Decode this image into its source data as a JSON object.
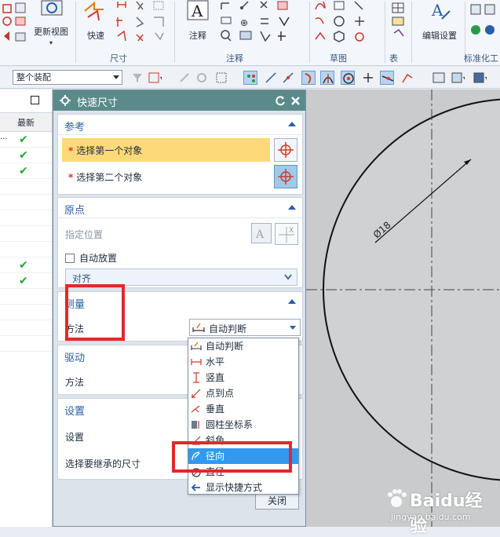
{
  "ribbon": {
    "groups": [
      {
        "label": "尺寸"
      },
      {
        "label": "注释"
      },
      {
        "label": "草图"
      },
      {
        "label": "表"
      },
      {
        "label": "标准化工"
      }
    ],
    "buttons": {
      "update_view": "更新视图",
      "quick": "快速",
      "note": "注释",
      "edit_settings": "编辑设置"
    }
  },
  "toolbar": {
    "assembly_filter": "整个装配"
  },
  "left_nav": {
    "column_latest": "最新",
    "truncated_text": "..."
  },
  "dialog": {
    "title": "快速尺寸",
    "reference": {
      "label": "参考",
      "first_object": "选择第一个对象",
      "second_object": "选择第二个对象",
      "required_mark": "*"
    },
    "origin": {
      "label": "原点",
      "specify_location": "指定位置",
      "auto_place": "自动放置",
      "align": "对齐"
    },
    "measure": {
      "label": "测量",
      "method_label": "方法",
      "method_value": "自动判断"
    },
    "drive": {
      "label": "驱动",
      "method_label": "方法"
    },
    "settings": {
      "label": "设置",
      "settings_label": "设置",
      "inherit_label": "选择要继承的尺寸"
    },
    "close_label": "关闭"
  },
  "method_options": [
    {
      "label": "自动判断",
      "icon": "auto-infer-icon"
    },
    {
      "label": "水平",
      "icon": "horizontal-dim-icon"
    },
    {
      "label": "竖直",
      "icon": "vertical-dim-icon"
    },
    {
      "label": "点到点",
      "icon": "point-to-point-icon"
    },
    {
      "label": "垂直",
      "icon": "perpendicular-icon"
    },
    {
      "label": "圆柱坐标系",
      "icon": "cylindrical-icon"
    },
    {
      "label": "斜角",
      "icon": "angular-icon"
    },
    {
      "label": "径向",
      "icon": "radial-icon"
    },
    {
      "label": "直径",
      "icon": "diameter-icon"
    },
    {
      "label": "显示快捷方式",
      "icon": "shortcut-arrow-icon"
    }
  ],
  "highlighted_option": "径向",
  "drawing": {
    "dimension_text": "Ø18"
  },
  "watermark": {
    "brand": "Baidu经验",
    "url": "jingyan.baidu.com"
  },
  "colors": {
    "accent_blue": "#2a5fa8",
    "title_bar": "#5a8a8a",
    "highlight_select": "#fdd97a",
    "menu_highlight": "#3399ee",
    "annotation_red": "#e02a2a",
    "check_green": "#22a832"
  }
}
